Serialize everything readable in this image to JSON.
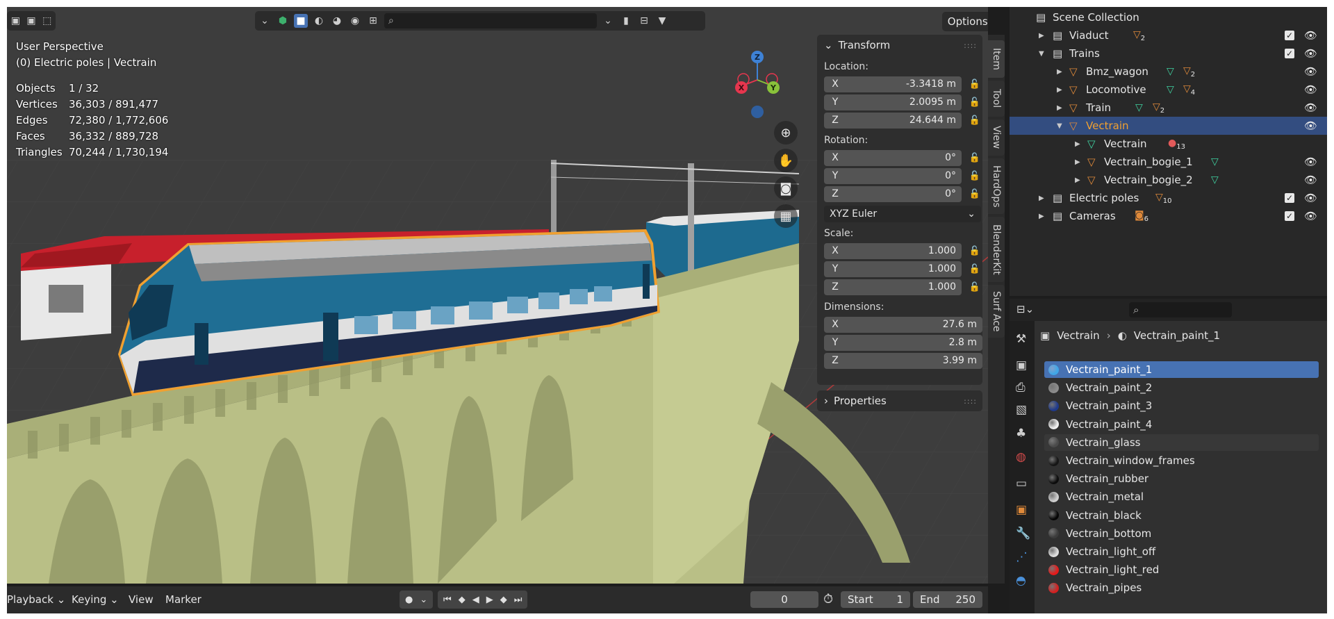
{
  "viewport": {
    "perspective_label": "User Perspective",
    "context_label": "(0) Electric poles | Vectrain",
    "stats": [
      {
        "label": "Objects",
        "value": "1 / 32"
      },
      {
        "label": "Vertices",
        "value": "36,303 / 891,477"
      },
      {
        "label": "Edges",
        "value": "72,380 / 1,772,606"
      },
      {
        "label": "Faces",
        "value": "36,332 / 889,728"
      },
      {
        "label": "Triangles",
        "value": "70,244 / 1,730,194"
      }
    ],
    "options_label": "Options",
    "search_placeholder": "",
    "gizmo": {
      "x": "X",
      "y": "Y",
      "z": "Z",
      "x_color": "#e6364e",
      "y_color": "#89c23a",
      "z_color": "#3e82d6"
    }
  },
  "npanel": {
    "transform_title": "Transform",
    "location_label": "Location:",
    "location": [
      {
        "axis": "X",
        "value": "-3.3418 m"
      },
      {
        "axis": "Y",
        "value": "2.0095 m"
      },
      {
        "axis": "Z",
        "value": "24.644 m"
      }
    ],
    "rotation_label": "Rotation:",
    "rotation": [
      {
        "axis": "X",
        "value": "0°"
      },
      {
        "axis": "Y",
        "value": "0°"
      },
      {
        "axis": "Z",
        "value": "0°"
      }
    ],
    "rotation_mode": "XYZ Euler",
    "scale_label": "Scale:",
    "scale": [
      {
        "axis": "X",
        "value": "1.000"
      },
      {
        "axis": "Y",
        "value": "1.000"
      },
      {
        "axis": "Z",
        "value": "1.000"
      }
    ],
    "dimensions_label": "Dimensions:",
    "dimensions": [
      {
        "axis": "X",
        "value": "27.6 m"
      },
      {
        "axis": "Y",
        "value": "2.8 m"
      },
      {
        "axis": "Z",
        "value": "3.99 m"
      }
    ],
    "properties_title": "Properties"
  },
  "vertical_tabs": [
    "Item",
    "Tool",
    "View",
    "HardOps",
    "BlenderKit",
    "Surf Ace"
  ],
  "timeline": {
    "menus": [
      "Playback",
      "Keying",
      "View",
      "Marker"
    ],
    "current_frame": "0",
    "start_label": "Start",
    "start_value": "1",
    "end_label": "End",
    "end_value": "250"
  },
  "outliner": {
    "root": "Scene Collection",
    "rows": [
      {
        "label": "Viaduct",
        "badge": "2"
      },
      {
        "label": "Trains",
        "badge": ""
      },
      {
        "label": "Bmz_wagon",
        "badge": "2"
      },
      {
        "label": "Locomotive",
        "badge": "4"
      },
      {
        "label": "Train",
        "badge": "2"
      },
      {
        "label": "Vectrain",
        "badge": ""
      },
      {
        "label": "Vectrain",
        "badge": "13"
      },
      {
        "label": "Vectrain_bogie_1",
        "badge": ""
      },
      {
        "label": "Vectrain_bogie_2",
        "badge": ""
      },
      {
        "label": "Electric poles",
        "badge": "10"
      },
      {
        "label": "Cameras",
        "badge": "6"
      }
    ]
  },
  "properties": {
    "search_placeholder": "",
    "breadcrumb_object": "Vectrain",
    "breadcrumb_material": "Vectrain_paint_1",
    "materials": [
      {
        "name": "Vectrain_paint_1",
        "color": "#3fa7e8"
      },
      {
        "name": "Vectrain_paint_2",
        "color": "#8c8c8c"
      },
      {
        "name": "Vectrain_paint_3",
        "color": "#1f3a8c"
      },
      {
        "name": "Vectrain_paint_4",
        "color": "#f0f0f0"
      },
      {
        "name": "Vectrain_glass",
        "color": "#4a4a4a"
      },
      {
        "name": "Vectrain_window_frames",
        "color": "#151515"
      },
      {
        "name": "Vectrain_rubber",
        "color": "#0c0c0c"
      },
      {
        "name": "Vectrain_metal",
        "color": "#cfcfcf"
      },
      {
        "name": "Vectrain_black",
        "color": "#050505"
      },
      {
        "name": "Vectrain_bottom",
        "color": "#3c3c3c"
      },
      {
        "name": "Vectrain_light_off",
        "color": "#dedede"
      },
      {
        "name": "Vectrain_light_red",
        "color": "#e61a1a"
      },
      {
        "name": "Vectrain_pipes",
        "color": "#d32020"
      }
    ]
  },
  "colors": {
    "accent": "#4772b3",
    "selection_outline": "#f0a030",
    "viaduct": "#b9bf86",
    "train_blue": "#1f6e94",
    "wagon_red": "#c7202c"
  }
}
